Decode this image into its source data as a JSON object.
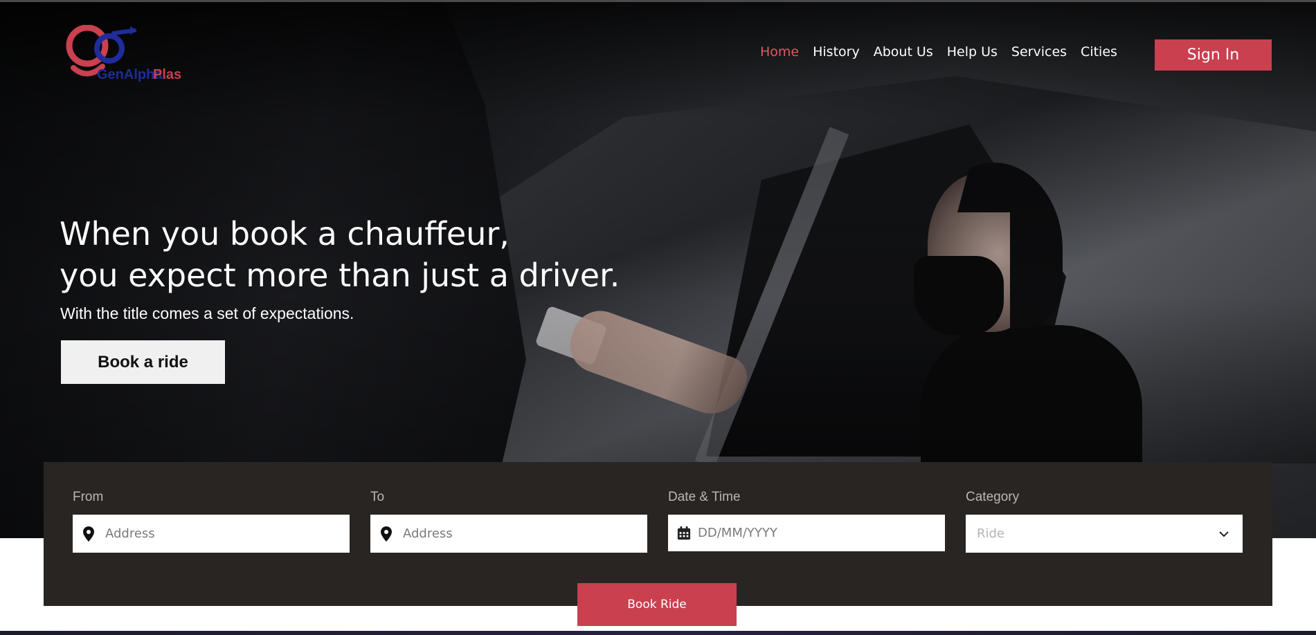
{
  "brand": {
    "name_part1": "GenAlpha",
    "name_part2": "Plas",
    "primary_color": "#c9404f",
    "secondary_color": "#1f2c9a"
  },
  "nav": {
    "items": [
      {
        "label": "Home",
        "active": true
      },
      {
        "label": "History",
        "active": false
      },
      {
        "label": "About Us",
        "active": false
      },
      {
        "label": "Help Us",
        "active": false
      },
      {
        "label": "Services",
        "active": false
      },
      {
        "label": "Cities",
        "active": false
      }
    ],
    "signin_label": "Sign In"
  },
  "hero": {
    "headline_line1": "When you book a chauffeur,",
    "headline_line2": "you expect more than just a driver.",
    "subline": "With the title comes a set of expectations.",
    "cta_label": "Book a ride"
  },
  "booking": {
    "from": {
      "label": "From",
      "placeholder": "Address",
      "icon": "location-pin-icon"
    },
    "to": {
      "label": "To",
      "placeholder": "Address",
      "icon": "location-pin-icon"
    },
    "datetime": {
      "label": "Date & Time",
      "placeholder": "DD/MM/YYYY",
      "icon": "calendar-icon"
    },
    "category": {
      "label": "Category",
      "selected": "Ride",
      "icon": "chevron-down-icon"
    },
    "submit_label": "Book Ride"
  }
}
